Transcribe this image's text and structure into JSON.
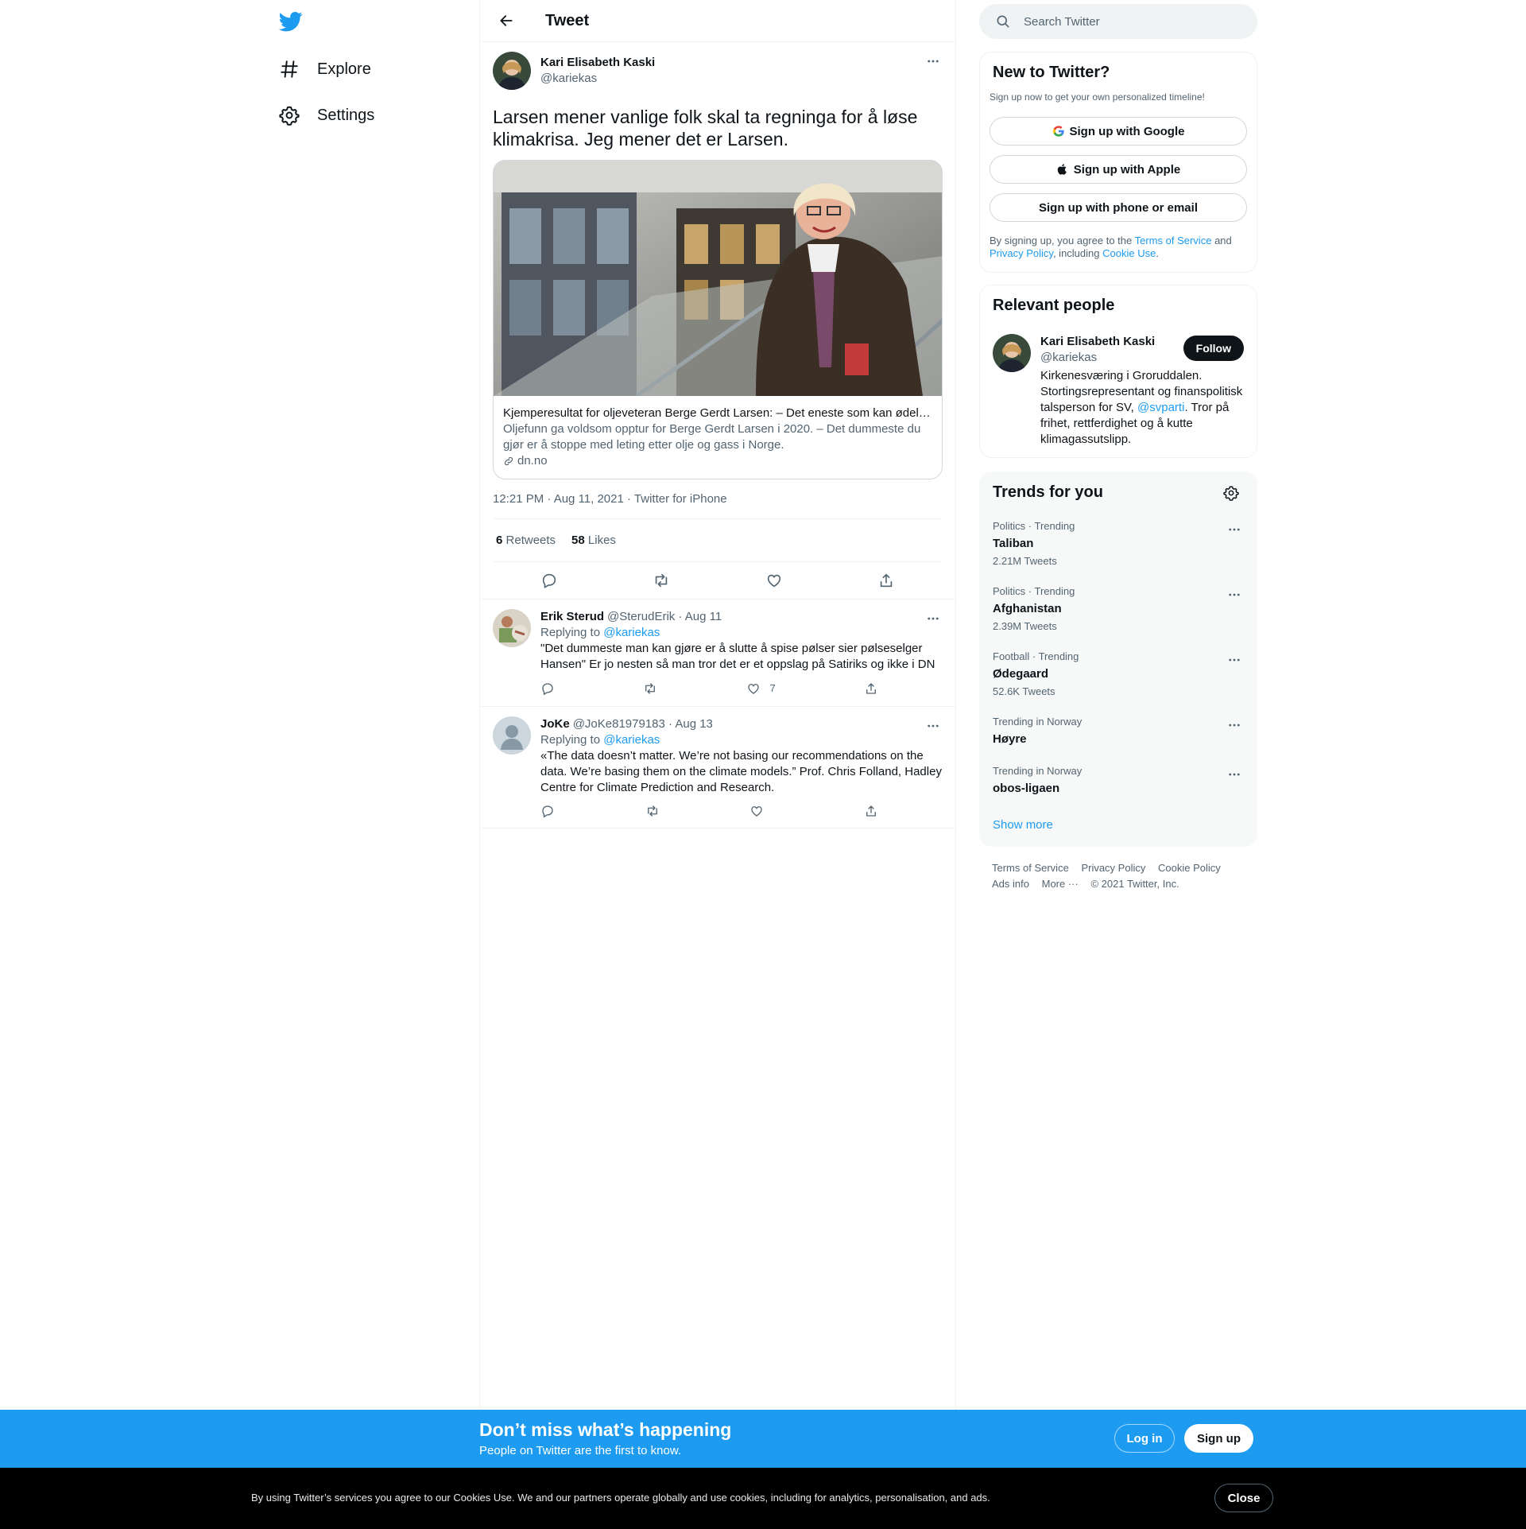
{
  "nav": {
    "items": [
      {
        "label": "Explore",
        "icon": "hashtag-icon"
      },
      {
        "label": "Settings",
        "icon": "gear-icon"
      }
    ]
  },
  "header": {
    "title": "Tweet"
  },
  "tweet": {
    "author_name": "Kari Elisabeth Kaski",
    "author_handle": "@kariekas",
    "text": "Larsen mener vanlige folk skal ta regninga for å løse klimakrisa. Jeg mener det er Larsen.",
    "card": {
      "title": "Kjemperesultat for oljeveteran Berge Gerdt Larsen: – Det eneste som kan ødelegge",
      "description": "Oljefunn ga voldsom opptur for Berge Gerdt Larsen i 2020. – Det dummeste du gjør er å stoppe med leting etter olje og gass i Norge.",
      "domain": "dn.no"
    },
    "meta": "12:21 PM · Aug 11, 2021 · Twitter for iPhone",
    "retweets_count": "6",
    "retweets_label": "Retweets",
    "likes_count": "58",
    "likes_label": "Likes"
  },
  "replies": [
    {
      "name": "Erik Sterud",
      "meta": "@SterudErik · Aug 11",
      "replying_prefix": "Replying to",
      "replying_to": "@kariekas",
      "text": "\"Det dummeste man kan gjøre er å slutte å spise pølser sier pølseselger Hansen\" Er jo nesten så man tror det er et oppslag på Satiriks og ikke i DN",
      "like_count": "7"
    },
    {
      "name": "JoKe",
      "meta": "@JoKe81979183 · Aug 13",
      "replying_prefix": "Replying to",
      "replying_to": "@kariekas",
      "text": "«The data doesn’t matter. We’re not basing our recommendations on the data. We’re basing them on the climate models.” Prof. Chris Folland, Hadley Centre for Climate Prediction and Research.",
      "like_count": ""
    }
  ],
  "search": {
    "placeholder": "Search Twitter"
  },
  "new_to_twitter": {
    "title": "New to Twitter?",
    "subtitle": "Sign up now to get your own personalized timeline!",
    "google": "Sign up with Google",
    "apple": "Sign up with Apple",
    "phone": "Sign up with phone or email",
    "legal_1": "By signing up, you agree to the",
    "terms": "Terms of Service",
    "legal_2": "and",
    "privacy": "Privacy Policy",
    "legal_3": ", including",
    "cookie": "Cookie Use",
    "legal_4": "."
  },
  "relevant_people": {
    "title": "Relevant people",
    "name": "Kari Elisabeth Kaski",
    "handle": "@kariekas",
    "follow": "Follow",
    "bio_1": "Kirkenesværing i Groruddalen. Stortingsrepresentant og finanspolitisk talsperson for SV, ",
    "bio_link": "@svparti",
    "bio_2": ". Tror på frihet, rettferdighet og å kutte klimagassutslipp."
  },
  "trends": {
    "title": "Trends for you",
    "items": [
      {
        "category": "Politics · Trending",
        "name": "Taliban",
        "count": "2.21M Tweets"
      },
      {
        "category": "Politics · Trending",
        "name": "Afghanistan",
        "count": "2.39M Tweets"
      },
      {
        "category": "Football · Trending",
        "name": "Ødegaard",
        "count": "52.6K Tweets"
      },
      {
        "category": "Trending in Norway",
        "name": "Høyre",
        "count": ""
      },
      {
        "category": "Trending in Norway",
        "name": "obos-ligaen",
        "count": ""
      }
    ],
    "show_more": "Show more"
  },
  "footer": {
    "terms": "Terms of Service",
    "privacy": "Privacy Policy",
    "cookie": "Cookie Policy",
    "ads": "Ads info",
    "more": "More ···",
    "copyright": "© 2021 Twitter, Inc."
  },
  "bottom_bar": {
    "title": "Don’t miss what’s happening",
    "subtitle": "People on Twitter are the first to know.",
    "login": "Log in",
    "signup": "Sign up"
  },
  "cookie_bar": {
    "text": "By using Twitter’s services you agree to our Cookies Use. We and our partners operate globally and use cookies, including for analytics, personalisation, and ads.",
    "close": "Close"
  },
  "colors": {
    "accent": "#1d9bf0",
    "text": "#0f1419",
    "secondary": "#536471",
    "border": "#eff3f4"
  }
}
